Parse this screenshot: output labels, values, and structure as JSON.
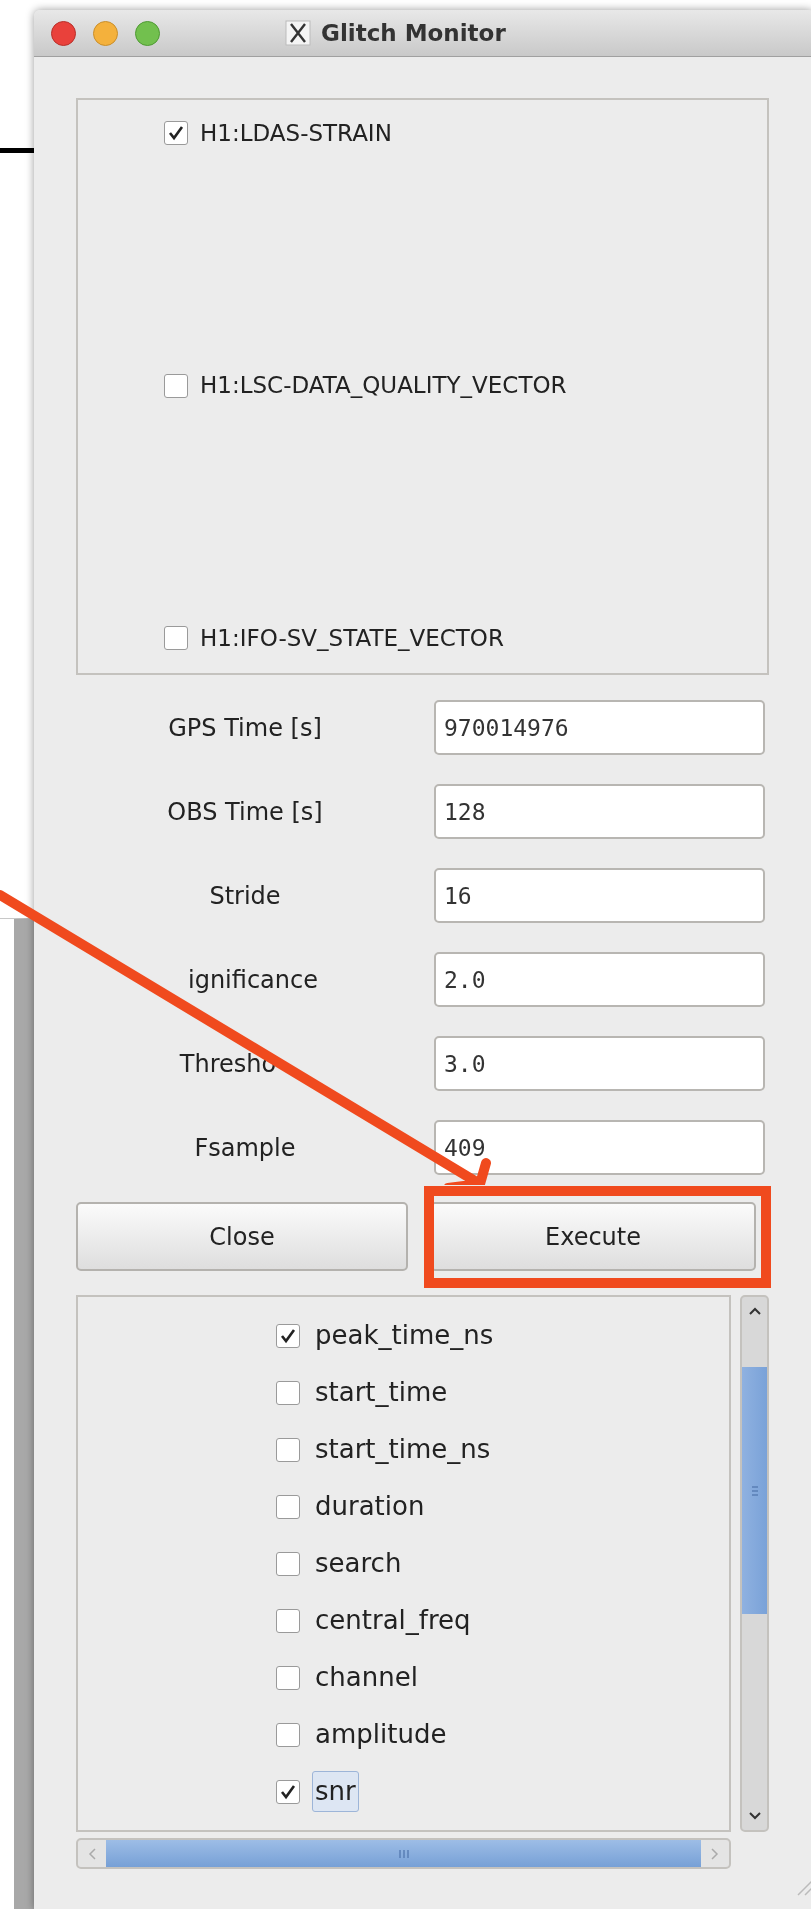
{
  "window": {
    "title": "Glitch Monitor"
  },
  "channels": [
    {
      "label": "H1:LDAS-STRAIN",
      "checked": true
    },
    {
      "label": "H1:LSC-DATA_QUALITY_VECTOR",
      "checked": false
    },
    {
      "label": "H1:IFO-SV_STATE_VECTOR",
      "checked": false
    }
  ],
  "fields": [
    {
      "label": "GPS Time [s]",
      "value": "970014976"
    },
    {
      "label": "OBS Time [s]",
      "value": "128"
    },
    {
      "label": "Stride",
      "value": "16"
    },
    {
      "label": "ignificance",
      "value": "2.0"
    },
    {
      "label": "Thresho",
      "value": "3.0"
    },
    {
      "label": "Fsample",
      "value": "409"
    }
  ],
  "buttons": [
    {
      "label": "Close"
    },
    {
      "label": "Execute"
    }
  ],
  "columns": [
    {
      "label": "peak_time_ns",
      "checked": true,
      "selected": false
    },
    {
      "label": "start_time",
      "checked": false,
      "selected": false
    },
    {
      "label": "start_time_ns",
      "checked": false,
      "selected": false
    },
    {
      "label": "duration",
      "checked": false,
      "selected": false
    },
    {
      "label": "search",
      "checked": false,
      "selected": false
    },
    {
      "label": "central_freq",
      "checked": false,
      "selected": false
    },
    {
      "label": "channel",
      "checked": false,
      "selected": false
    },
    {
      "label": "amplitude",
      "checked": false,
      "selected": false
    },
    {
      "label": "snr",
      "checked": true,
      "selected": true
    }
  ]
}
